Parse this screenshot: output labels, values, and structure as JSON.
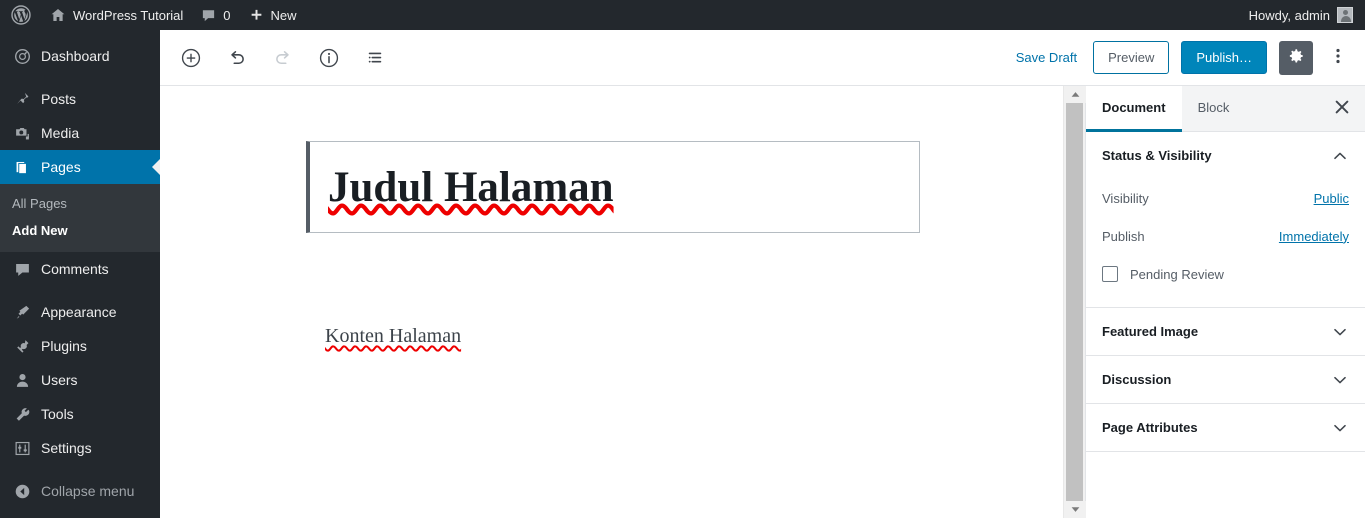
{
  "admin_bar": {
    "wp_logo_icon": "wordpress-logo-icon",
    "site_home_icon": "home-icon",
    "site_name": "WordPress Tutorial",
    "comments_icon": "comment-bubble-icon",
    "comments_count": "0",
    "new_icon": "plus-icon",
    "new_label": "New",
    "howdy": "Howdy, admin",
    "avatar_icon": "user-avatar-icon"
  },
  "sidebar": {
    "items": [
      {
        "label": "Dashboard",
        "icon": "dashboard-gauge-icon",
        "active": false
      },
      {
        "label": "Posts",
        "icon": "pin-icon",
        "active": false
      },
      {
        "label": "Media",
        "icon": "media-camera-music-icon",
        "active": false
      },
      {
        "label": "Pages",
        "icon": "pages-document-icon",
        "active": true
      },
      {
        "label": "Comments",
        "icon": "comment-bubble-icon",
        "active": false
      },
      {
        "label": "Appearance",
        "icon": "paintbrush-icon",
        "active": false
      },
      {
        "label": "Plugins",
        "icon": "plug-icon",
        "active": false
      },
      {
        "label": "Users",
        "icon": "user-icon",
        "active": false
      },
      {
        "label": "Tools",
        "icon": "wrench-icon",
        "active": false
      },
      {
        "label": "Settings",
        "icon": "sliders-icon",
        "active": false
      }
    ],
    "submenu": [
      {
        "label": "All Pages",
        "active": false
      },
      {
        "label": "Add New",
        "active": true
      }
    ],
    "collapse": {
      "label": "Collapse menu",
      "icon": "arrow-left-circle-icon"
    },
    "active_color": "#0073aa"
  },
  "editor_header": {
    "tools": [
      {
        "name": "add-block-button",
        "icon": "plus-circle-icon",
        "disabled": false
      },
      {
        "name": "undo-button",
        "icon": "undo-arrow-icon",
        "disabled": false
      },
      {
        "name": "redo-button",
        "icon": "redo-arrow-icon",
        "disabled": true
      },
      {
        "name": "content-info-button",
        "icon": "info-circle-icon",
        "disabled": false
      },
      {
        "name": "block-navigation-button",
        "icon": "list-view-icon",
        "disabled": false
      }
    ],
    "save_draft_label": "Save Draft",
    "preview_label": "Preview",
    "publish_label": "Publish…",
    "settings_gear_icon": "gear-icon",
    "more_menu_icon": "vertical-dots-icon",
    "publish_color": "#0085ba",
    "link_color": "#0073aa"
  },
  "content": {
    "title": "Judul Halaman",
    "paragraph": "Konten Halaman",
    "spellcheck_color": "#ee0000",
    "selected_block_border": "#555d66"
  },
  "settings_panel": {
    "tabs": [
      {
        "label": "Document",
        "active": true
      },
      {
        "label": "Block",
        "active": false
      }
    ],
    "close_icon": "close-x-icon",
    "panels": [
      {
        "title": "Status & Visibility",
        "expanded": true,
        "chevron_icon": "chevron-up-icon",
        "rows": [
          {
            "label": "Visibility",
            "value": "Public"
          },
          {
            "label": "Publish",
            "value": "Immediately"
          }
        ],
        "checkbox": {
          "label": "Pending Review",
          "checked": false,
          "icon": "checkbox-unchecked-icon"
        }
      },
      {
        "title": "Featured Image",
        "expanded": false,
        "chevron_icon": "chevron-down-icon"
      },
      {
        "title": "Discussion",
        "expanded": false,
        "chevron_icon": "chevron-down-icon"
      },
      {
        "title": "Page Attributes",
        "expanded": false,
        "chevron_icon": "chevron-down-icon"
      }
    ],
    "active_tab_underline": "#00739c"
  },
  "scrollbar": {
    "up_arrow_icon": "scroll-up-arrow-icon",
    "down_arrow_icon": "scroll-down-arrow-icon"
  }
}
